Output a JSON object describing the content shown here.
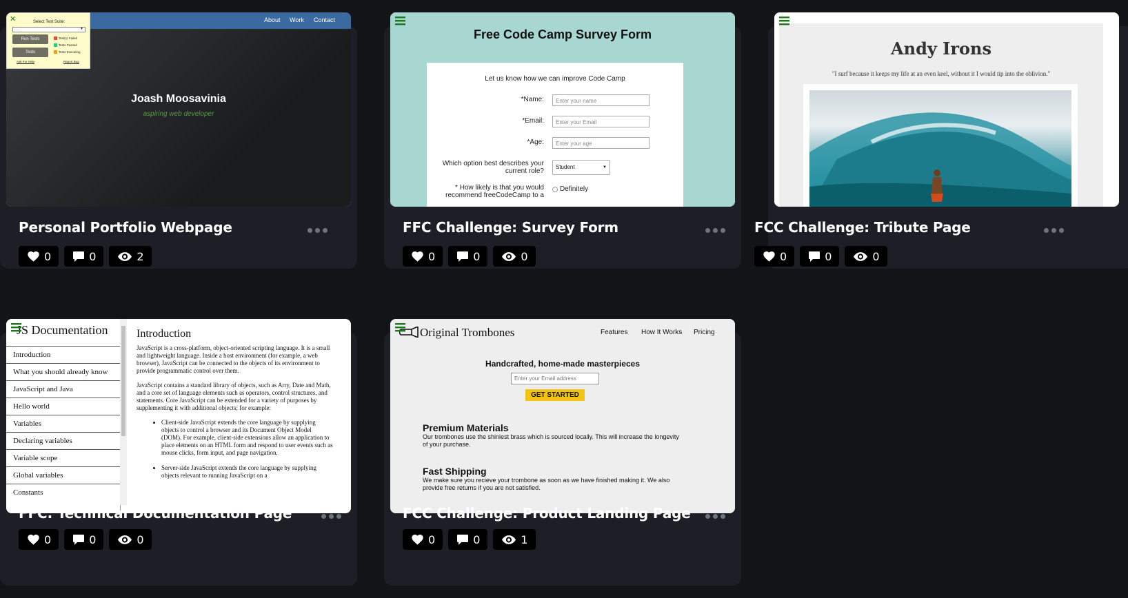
{
  "cards": [
    {
      "title": "Personal Portfolio Webpage",
      "likes": "0",
      "comments": "0",
      "views": "2",
      "preview": {
        "nav": [
          "About",
          "Work",
          "Contact"
        ],
        "name": "Joash Moosavinia",
        "subtitle": "aspiring web developer",
        "test_suite": {
          "close": "✕",
          "title": "Select Test Suite:",
          "select_value": "- - -",
          "run_button": "Run Tests",
          "tests_button": "Tests",
          "legend": [
            "Test(s) Failed",
            "Tests Passed",
            "Tests Executing"
          ],
          "legend_colors": [
            "#e74c3c",
            "#2ecc71",
            "#f39c12"
          ],
          "help_link": "Ask For Help",
          "bug_link": "Report Bug"
        }
      }
    },
    {
      "title": "FFC Challenge: Survey Form",
      "likes": "0",
      "comments": "0",
      "views": "0",
      "preview": {
        "heading": "Free Code Camp Survey Form",
        "lead": "Let us know how we can improve Code Camp",
        "name_label": "*Name:",
        "name_placeholder": "Enter your name",
        "email_label": "*Email:",
        "email_placeholder": "Enter your Email",
        "age_label": "*Age:",
        "age_placeholder": "Enter your age",
        "role_label_1": "Which option best describes your",
        "role_label_2": "current role?",
        "role_value": "Student",
        "likely_label_1": "* How likely is that you would",
        "likely_label_2": "recommend freeCodeCamp to a",
        "likely_option": "Definitely"
      }
    },
    {
      "title": "FCC Challenge: Tribute Page",
      "likes": "0",
      "comments": "0",
      "views": "0",
      "preview": {
        "heading": "Andy Irons",
        "quote": "\"I surf because it keeps my life at an even keel, without it I would tip into the oblivion.\""
      }
    },
    {
      "title": "FFC: Technical Documentation Page",
      "likes": "0",
      "comments": "0",
      "views": "0",
      "preview": {
        "sidebar_title": "JS Documentation",
        "nav": [
          "Introduction",
          "What you should already know",
          "JavaScript and Java",
          "Hello world",
          "Variables",
          "Declaring variables",
          "Variable scope",
          "Global variables",
          "Constants"
        ],
        "section_title": "Introduction",
        "p1": "JavaScript is a cross-platform, object-oriented scripting language. It is a small and lightweight language. Inside a host environment (for example, a web browser), JavaScript can be connected to the objects of its environment to provide programmatic control over them.",
        "p2": "JavaScript contains a standard library of objects, such as Arry, Date and Math, and a core set of language elements such as operators, control structures, and statements. Core JavaScript can be extended for a variety of purposes by supplementing it with additional objects; for example:",
        "li1": "Client-side JavaScript extends the core language by supplying objects to control a browser and its Document Object Model (DOM). For example, client-side extensions allow an application to place elements on an HTML form and respond to user events such as mouse clicks, form input, and page navigation.",
        "li2": "Server-side JavaScript extends the core language by supplying objects relevant to running JavaScript on a"
      }
    },
    {
      "title": "FCC Challenge: Product Landing Page",
      "likes": "0",
      "comments": "0",
      "views": "1",
      "preview": {
        "brand": "Original Trombones",
        "nav": [
          "Features",
          "How It Works",
          "Pricing"
        ],
        "hero": "Handcrafted, home-made masterpieces",
        "email_placeholder": "Enter your Email address",
        "cta": "GET STARTED",
        "f1_title": "Premium Materials",
        "f1_text": "Our trombones use the shiniest brass which is sourced locally. This will increase the longevity of your purchase.",
        "f2_title": "Fast Shipping",
        "f2_text": "We make sure you recieve your trombone as soon as we have finished making it. We also provide free returns if you are not satisfied."
      }
    }
  ],
  "icons": {
    "like": "heart-icon",
    "comment": "comment-icon",
    "view": "eye-icon",
    "more": "more-dots-icon",
    "menu": "hamburger-menu-icon"
  },
  "colors": {
    "page_bg": "#131417",
    "card_bg": "#1e1f26",
    "menu_icon": "#1a7a1a"
  }
}
